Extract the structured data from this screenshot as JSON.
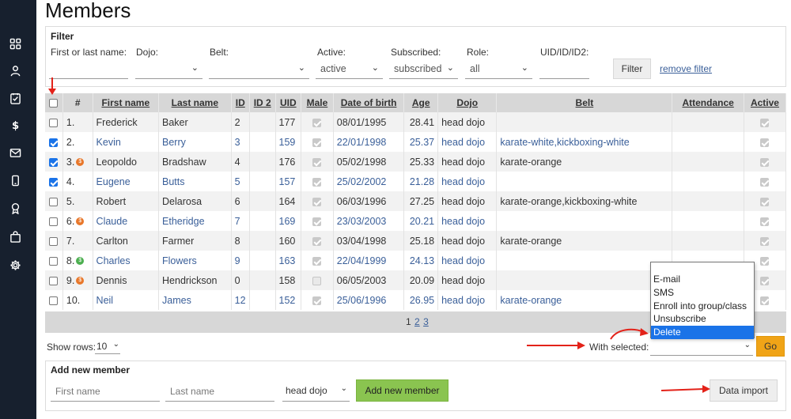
{
  "page": {
    "title": "Members"
  },
  "sidebar": {
    "items": [
      {
        "name": "dashboard",
        "icon": "grid-icon"
      },
      {
        "name": "members",
        "icon": "user-icon"
      },
      {
        "name": "attendance",
        "icon": "checklist-icon"
      },
      {
        "name": "payments",
        "icon": "dollar-icon"
      },
      {
        "name": "mail",
        "icon": "envelope-icon"
      },
      {
        "name": "mobile",
        "icon": "phone-icon"
      },
      {
        "name": "grading",
        "icon": "award-icon"
      },
      {
        "name": "shop",
        "icon": "bag-icon"
      },
      {
        "name": "settings",
        "icon": "gear-icon"
      }
    ],
    "background": "#17202e"
  },
  "filter": {
    "legend": "Filter",
    "name_label": "First or last name:",
    "dojo_label": "Dojo:",
    "belt_label": "Belt:",
    "active_label": "Active:",
    "active_value": "active",
    "subscribed_label": "Subscribed:",
    "subscribed_value": "subscribed",
    "role_label": "Role:",
    "role_value": "all",
    "uid_label": "UID/ID/ID2:",
    "filter_button": "Filter",
    "remove_link": "remove filter"
  },
  "table": {
    "headers": {
      "num": "#",
      "first_name": "First name",
      "last_name": "Last name",
      "id": "ID",
      "id2": "ID 2",
      "uid": "UID",
      "male": "Male",
      "dob": "Date of birth",
      "age": "Age",
      "dojo": "Dojo",
      "belt": "Belt",
      "attendance": "Attendance",
      "active": "Active"
    },
    "rows": [
      {
        "checked": false,
        "num": "1.",
        "coin": "",
        "first": "Frederick",
        "last": "Baker",
        "id": "2",
        "id2": "",
        "uid": "177",
        "male": true,
        "dob": "08/01/1995",
        "age": "28.41",
        "dojo": "head dojo",
        "belt": "",
        "attendance": "",
        "active": true
      },
      {
        "checked": true,
        "num": "2.",
        "coin": "",
        "first": "Kevin",
        "last": "Berry",
        "id": "3",
        "id2": "",
        "uid": "159",
        "male": true,
        "dob": "22/01/1998",
        "age": "25.37",
        "dojo": "head dojo",
        "belt": "karate-white,kickboxing-white",
        "attendance": "",
        "active": true
      },
      {
        "checked": true,
        "num": "3.",
        "coin": "orange",
        "first": "Leopoldo",
        "last": "Bradshaw",
        "id": "4",
        "id2": "",
        "uid": "176",
        "male": true,
        "dob": "05/02/1998",
        "age": "25.33",
        "dojo": "head dojo",
        "belt": "karate-orange",
        "attendance": "",
        "active": true
      },
      {
        "checked": true,
        "num": "4.",
        "coin": "",
        "first": "Eugene",
        "last": "Butts",
        "id": "5",
        "id2": "",
        "uid": "157",
        "male": true,
        "dob": "25/02/2002",
        "age": "21.28",
        "dojo": "head dojo",
        "belt": "",
        "attendance": "",
        "active": true
      },
      {
        "checked": false,
        "num": "5.",
        "coin": "",
        "first": "Robert",
        "last": "Delarosa",
        "id": "6",
        "id2": "",
        "uid": "164",
        "male": true,
        "dob": "06/03/1996",
        "age": "27.25",
        "dojo": "head dojo",
        "belt": "karate-orange,kickboxing-white",
        "attendance": "",
        "active": true
      },
      {
        "checked": false,
        "num": "6.",
        "coin": "orange",
        "first": "Claude",
        "last": "Etheridge",
        "id": "7",
        "id2": "",
        "uid": "169",
        "male": true,
        "dob": "23/03/2003",
        "age": "20.21",
        "dojo": "head dojo",
        "belt": "",
        "attendance": "",
        "active": true
      },
      {
        "checked": false,
        "num": "7.",
        "coin": "",
        "first": "Carlton",
        "last": "Farmer",
        "id": "8",
        "id2": "",
        "uid": "160",
        "male": true,
        "dob": "03/04/1998",
        "age": "25.18",
        "dojo": "head dojo",
        "belt": "karate-orange",
        "attendance": "",
        "active": true
      },
      {
        "checked": false,
        "num": "8.",
        "coin": "green",
        "first": "Charles",
        "last": "Flowers",
        "id": "9",
        "id2": "",
        "uid": "163",
        "male": true,
        "dob": "22/04/1999",
        "age": "24.13",
        "dojo": "head dojo",
        "belt": "",
        "attendance": "",
        "active": true
      },
      {
        "checked": false,
        "num": "9.",
        "coin": "orange",
        "first": "Dennis",
        "last": "Hendrickson",
        "id": "0",
        "id2": "",
        "uid": "158",
        "male": false,
        "dob": "06/05/2003",
        "age": "20.09",
        "dojo": "head dojo",
        "belt": "",
        "attendance": "",
        "active": true
      },
      {
        "checked": false,
        "num": "10.",
        "coin": "",
        "first": "Neil",
        "last": "James",
        "id": "12",
        "id2": "",
        "uid": "152",
        "male": true,
        "dob": "25/06/1996",
        "age": "26.95",
        "dojo": "head dojo",
        "belt": "karate-orange",
        "attendance": "",
        "active": true
      }
    ]
  },
  "pager": {
    "current": "1",
    "pages": [
      "2",
      "3"
    ]
  },
  "bulk": {
    "show_rows_label": "Show rows:",
    "show_rows_value": "10",
    "with_selected_label": "With selected:",
    "go_button": "Go",
    "options": [
      "E-mail",
      "SMS",
      "Enroll into group/class",
      "Unsubscribe",
      "Delete"
    ],
    "highlighted_option": "Delete"
  },
  "add_member": {
    "legend": "Add new member",
    "first_placeholder": "First name",
    "last_placeholder": "Last name",
    "dojo_value": "head dojo",
    "add_button": "Add new member",
    "import_button": "Data import"
  },
  "colors": {
    "accent_blue": "#1a73e8",
    "go_orange": "#f0a417",
    "add_green": "#8ac450",
    "annotation_red": "#e32219",
    "link_blue": "#3a5f99"
  }
}
